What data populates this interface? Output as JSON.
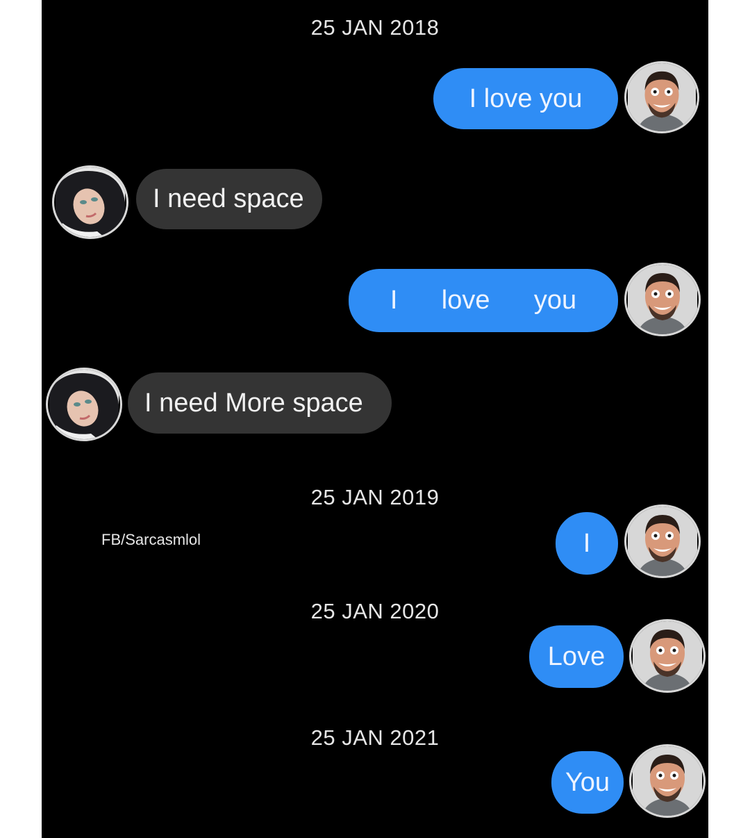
{
  "dates": {
    "d2018": "25 JAN 2018",
    "d2019": "25 JAN 2019",
    "d2020": "25 JAN 2020",
    "d2021": "25 JAN 2021"
  },
  "watermark": "FB/Sarcasmlol",
  "messages": [
    {
      "sender": "man",
      "text": "I love you"
    },
    {
      "sender": "woman",
      "text": "I need space"
    },
    {
      "sender": "man",
      "text": "I      love      you"
    },
    {
      "sender": "woman",
      "text": "I need More space"
    },
    {
      "sender": "man",
      "text": "I"
    },
    {
      "sender": "man",
      "text": "Love"
    },
    {
      "sender": "man",
      "text": "You"
    }
  ],
  "avatars": {
    "man": "smiling-man-avatar",
    "woman": "woman-avatar"
  },
  "colors": {
    "background": "#000000",
    "sent_bubble": "#2f8df5",
    "received_bubble": "#343434",
    "text": "#eef4ff"
  }
}
